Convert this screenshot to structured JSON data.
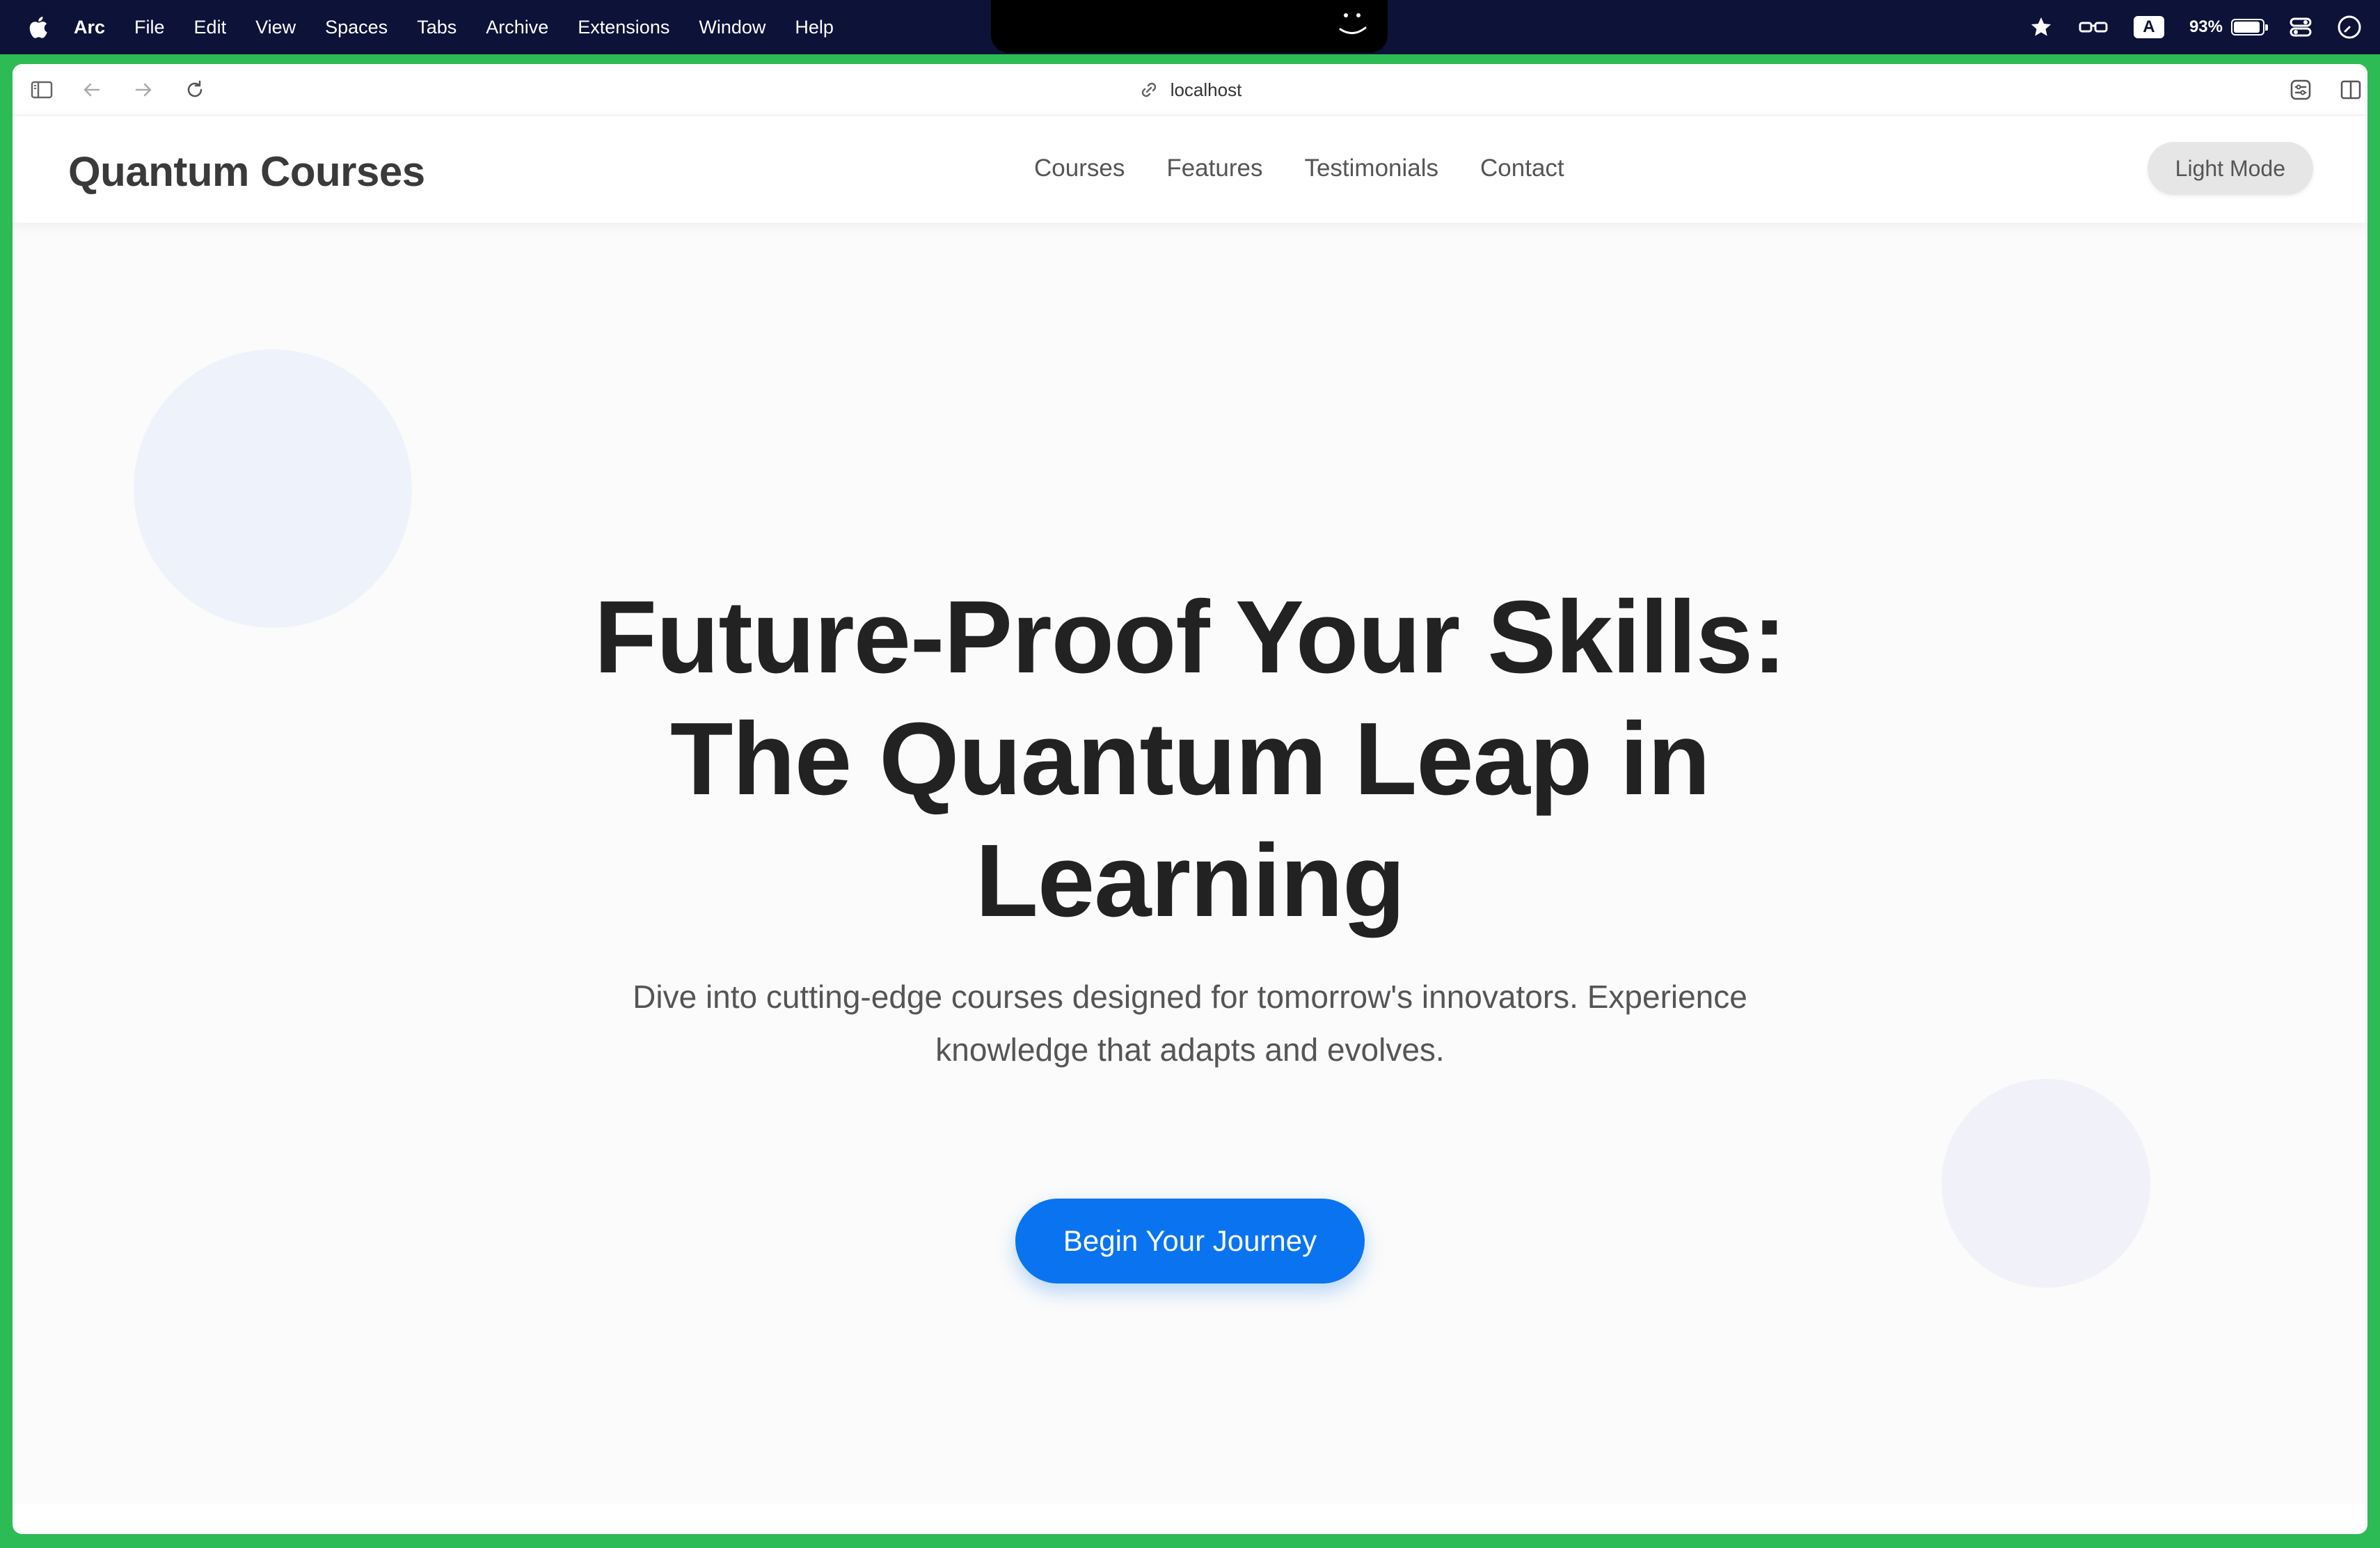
{
  "menubar": {
    "app_name": "Arc",
    "items": [
      "File",
      "Edit",
      "View",
      "Spaces",
      "Tabs",
      "Archive",
      "Extensions",
      "Window",
      "Help"
    ],
    "status": {
      "keyboard_badge": "A",
      "battery_percent": "93%",
      "battery_level": 0.93
    }
  },
  "browser": {
    "url": "localhost"
  },
  "site": {
    "logo": "Quantum Courses",
    "nav": [
      "Courses",
      "Features",
      "Testimonials",
      "Contact"
    ],
    "mode_button": "Light Mode"
  },
  "hero": {
    "title_lines": [
      "Future-Proof Your Skills:",
      "The Quantum Leap in",
      "Learning"
    ],
    "subtitle": "Dive into cutting-edge courses designed for tomorrow's innovators. Experience knowledge that adapts and evolves.",
    "cta": "Begin Your Journey"
  },
  "colors": {
    "frame": "#2dbb55",
    "menubar": "#0c1238",
    "accent": "#0a74f0"
  },
  "icons": [
    "apple-icon",
    "face-icon",
    "star-icon",
    "glasses-icon",
    "control-center-icon",
    "clock-icon",
    "sidebar-toggle-icon",
    "back-icon",
    "forward-icon",
    "reload-icon",
    "link-icon",
    "extensions-icon",
    "split-view-icon"
  ]
}
